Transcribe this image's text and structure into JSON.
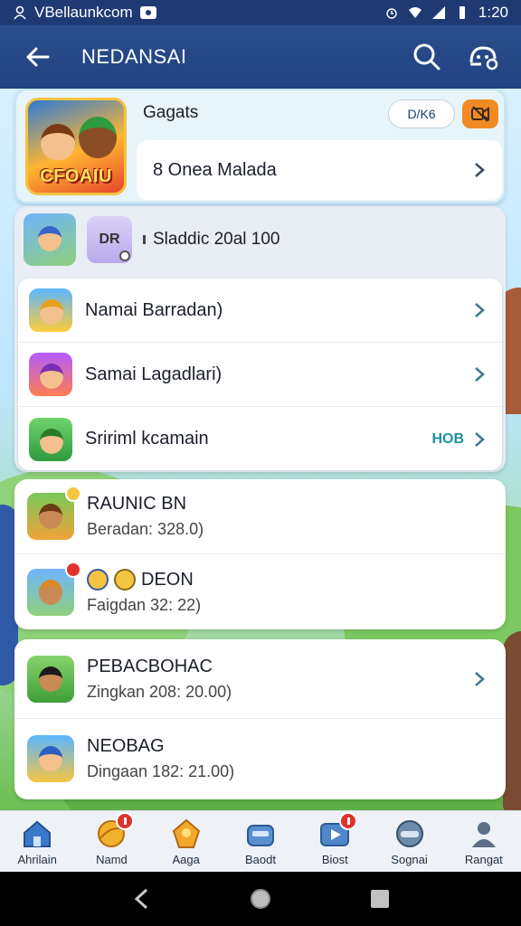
{
  "status_bar": {
    "carrier": "VBellaunkcom",
    "time": "1:20"
  },
  "app_bar": {
    "title": "NEDANSAI"
  },
  "top_card": {
    "game_logo": "CFOAIU",
    "title": "Gagats",
    "pill_label": "D/K6",
    "row_label": "8 Onea Malada"
  },
  "group": {
    "badge": "DR",
    "summary": "Sladdic 20al 100",
    "items": [
      {
        "label": "Namai Barradan)",
        "tail": ""
      },
      {
        "label": "Samai Lagadlari)",
        "tail": ""
      },
      {
        "label": "Sririml kcamain",
        "tail": "HOB"
      }
    ]
  },
  "players": [
    {
      "name": "RAUNIC BN",
      "sub": "Beradan: 328.0)"
    },
    {
      "name": "DEON",
      "sub": "Faigdan 32: 22)"
    }
  ],
  "players2": [
    {
      "name": "PEBACBOHAC",
      "sub": "Zingkan 208: 20.00)"
    },
    {
      "name": "NEOBAG",
      "sub": "Dingaan 182: 21.00)"
    }
  ],
  "bottom_nav": [
    {
      "label": "Ahrilain",
      "icon": "home-icon",
      "badge": false
    },
    {
      "label": "Namd",
      "icon": "ball-icon",
      "badge": true
    },
    {
      "label": "Aaga",
      "icon": "trophy-icon",
      "badge": false
    },
    {
      "label": "Baodt",
      "icon": "chest-icon",
      "badge": false
    },
    {
      "label": "Biost",
      "icon": "play-icon",
      "badge": true
    },
    {
      "label": "Sognai",
      "icon": "helmet-icon",
      "badge": false
    },
    {
      "label": "Rangat",
      "icon": "profile-icon",
      "badge": false
    }
  ],
  "colors": {
    "app_bar": "#234381",
    "accent_orange": "#f08a23",
    "badge_red": "#e0312b",
    "teal_text": "#1f8fa0"
  }
}
